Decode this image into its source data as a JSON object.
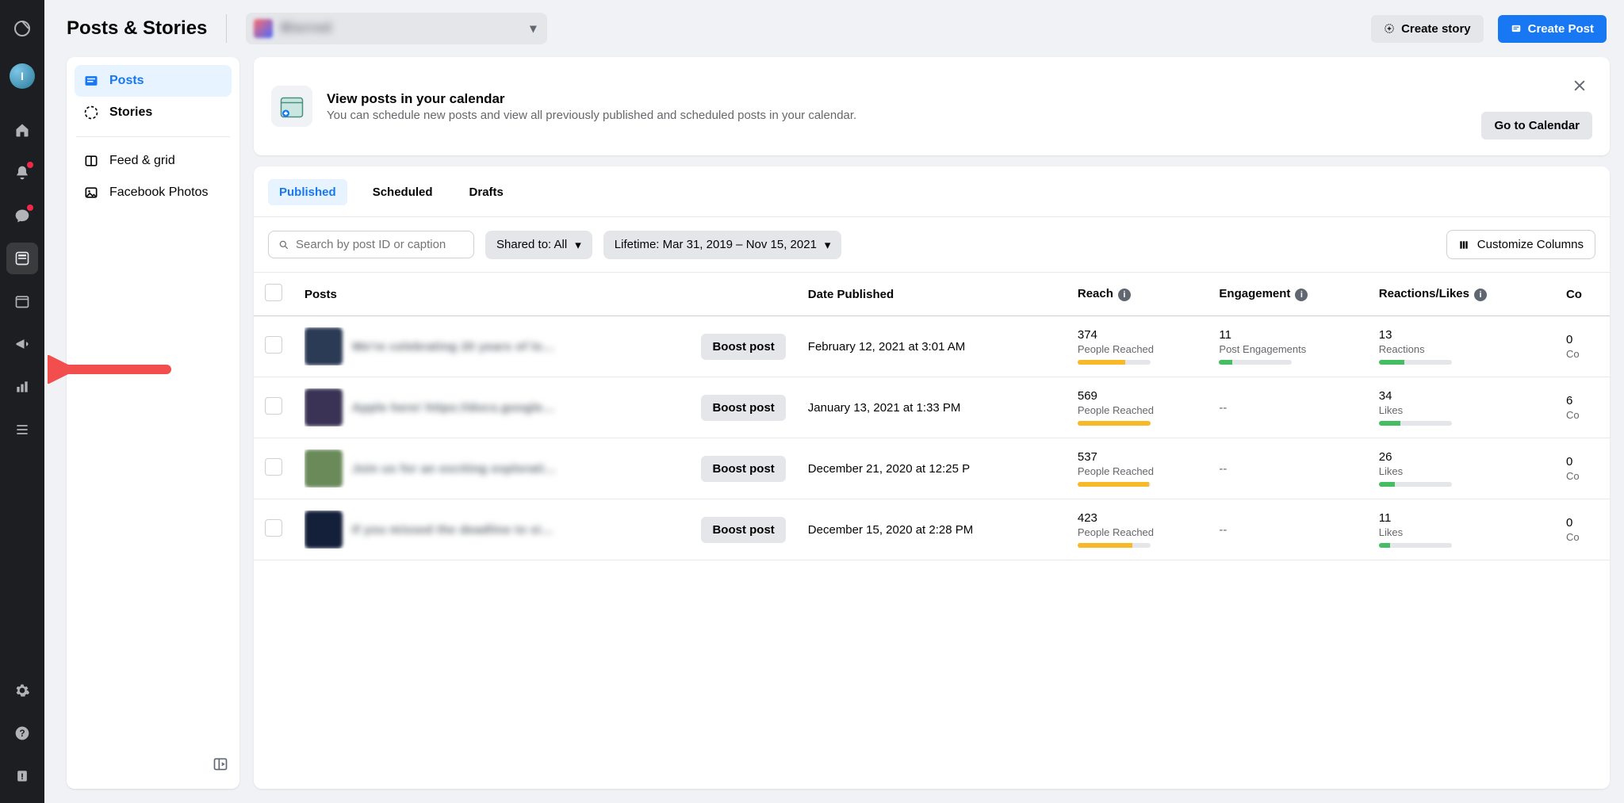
{
  "header": {
    "title": "Posts & Stories",
    "account_name": "Blurred",
    "create_story": "Create story",
    "create_post": "Create Post"
  },
  "sidebar": {
    "items": [
      {
        "label": "Posts"
      },
      {
        "label": "Stories"
      },
      {
        "label": "Feed & grid"
      },
      {
        "label": "Facebook Photos"
      }
    ]
  },
  "banner": {
    "title": "View posts in your calendar",
    "subtitle": "You can schedule new posts and view all previously published and scheduled posts in your calendar.",
    "cta": "Go to Calendar"
  },
  "tabs": {
    "published": "Published",
    "scheduled": "Scheduled",
    "drafts": "Drafts"
  },
  "filters": {
    "search_placeholder": "Search by post ID or caption",
    "shared_to": "Shared to: All",
    "date_range": "Lifetime: Mar 31, 2019 – Nov 15, 2021",
    "customize": "Customize Columns"
  },
  "columns": {
    "posts": "Posts",
    "date": "Date Published",
    "reach": "Reach",
    "engagement": "Engagement",
    "reactions": "Reactions/Likes",
    "comments": "Co"
  },
  "boost_label": "Boost post",
  "rows": [
    {
      "caption": "We're celebrating 20 years of love…",
      "thumb_color": "#2b3a55",
      "date": "February 12, 2021 at 3:01 AM",
      "reach_val": "374",
      "reach_lbl": "People Reached",
      "reach_pct": 65,
      "eng_val": "11",
      "eng_lbl": "Post Engagements",
      "eng_pct": 18,
      "react_val": "13",
      "react_lbl": "Reactions",
      "react_pct": 35,
      "comments_val": "0",
      "comments_lbl": "Co"
    },
    {
      "caption": "Apple here! https://docs.google…",
      "thumb_color": "#3a3355",
      "date": "January 13, 2021 at 1:33 PM",
      "reach_val": "569",
      "reach_lbl": "People Reached",
      "reach_pct": 100,
      "eng_val": "--",
      "eng_lbl": "",
      "eng_pct": 0,
      "react_val": "34",
      "react_lbl": "Likes",
      "react_pct": 30,
      "comments_val": "6",
      "comments_lbl": "Co"
    },
    {
      "caption": "Join us for an exciting explorative…",
      "thumb_color": "#6a8a5a",
      "date": "December 21, 2020 at 12:25 P",
      "reach_val": "537",
      "reach_lbl": "People Reached",
      "reach_pct": 98,
      "eng_val": "--",
      "eng_lbl": "",
      "eng_pct": 0,
      "react_val": "26",
      "react_lbl": "Likes",
      "react_pct": 22,
      "comments_val": "0",
      "comments_lbl": "Co"
    },
    {
      "caption": "If you missed the deadline to sign…",
      "thumb_color": "#14203a",
      "date": "December 15, 2020 at 2:28 PM",
      "reach_val": "423",
      "reach_lbl": "People Reached",
      "reach_pct": 75,
      "eng_val": "--",
      "eng_lbl": "",
      "eng_pct": 0,
      "react_val": "11",
      "react_lbl": "Likes",
      "react_pct": 15,
      "comments_val": "0",
      "comments_lbl": "Co"
    }
  ]
}
